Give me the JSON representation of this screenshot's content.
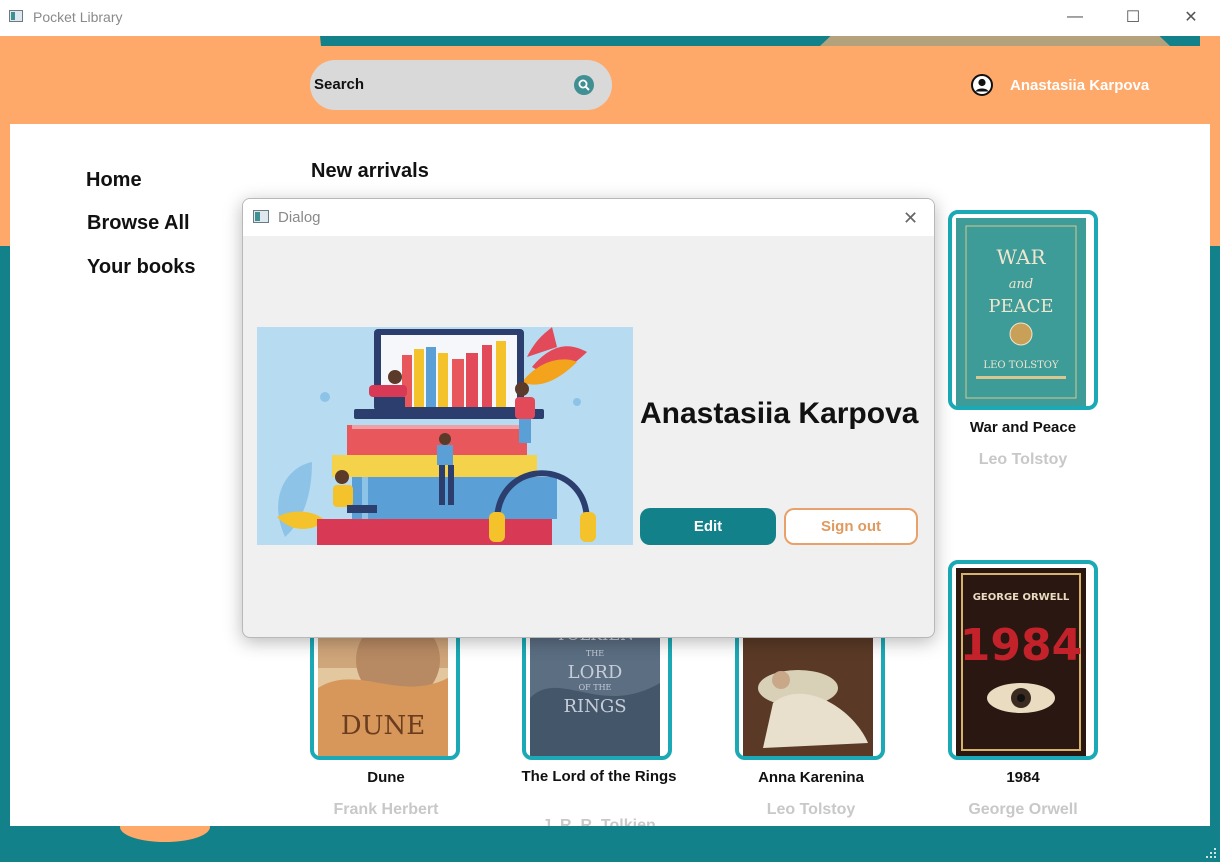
{
  "window": {
    "title": "Pocket Library",
    "minimize": "—",
    "maximize": "☐",
    "close": "✕"
  },
  "header": {
    "search_label": "Search",
    "user_name": "Anastasiia Karpova"
  },
  "nav": [
    {
      "label": "Home"
    },
    {
      "label": "Browse All"
    },
    {
      "label": "Your books"
    }
  ],
  "section_title": "New arrivals",
  "books": [
    {
      "title": "War and Peace",
      "author": "Leo Tolstoy",
      "cover_text": [
        "WAR",
        "and",
        "PEACE",
        "LEO TOLSTOY"
      ]
    },
    {
      "title": "Dune",
      "author": "Frank Herbert",
      "cover_text": [
        "DUNE"
      ]
    },
    {
      "title": "The Lord of the Rings",
      "author": "J. R. R. Tolkien",
      "cover_text": [
        "TOLKIEN",
        "THE",
        "LORD",
        "OF THE",
        "RINGS"
      ]
    },
    {
      "title": "Anna Karenina",
      "author": "Leo Tolstoy"
    },
    {
      "title": "1984",
      "author": "George Orwell",
      "cover_text": [
        "GEORGE ORWELL",
        "1984"
      ]
    }
  ],
  "dialog": {
    "title": "Dialog",
    "close": "✕",
    "user_name": "Anastasiia Karpova",
    "edit_label": "Edit",
    "signout_label": "Sign out"
  },
  "colors": {
    "teal": "#13818a",
    "orange": "#fea96a",
    "card_border": "#1aa9b5",
    "author_gray": "#c8c8c8"
  }
}
